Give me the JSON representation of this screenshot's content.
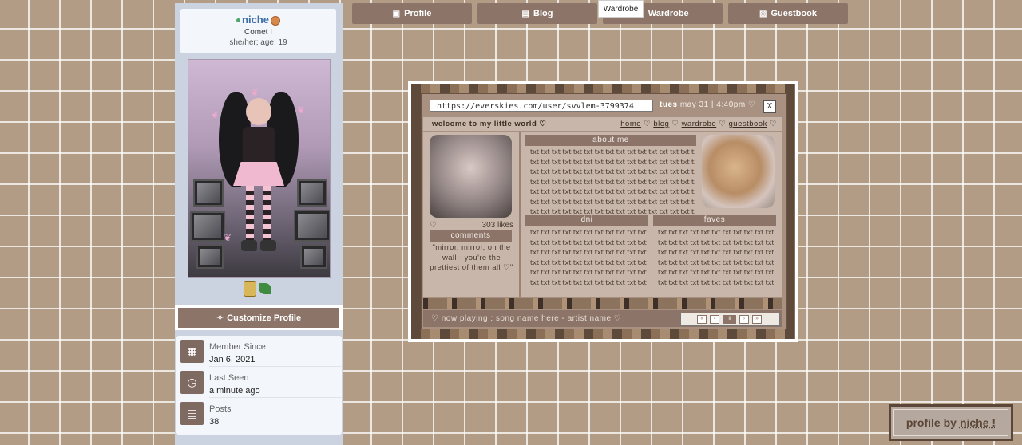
{
  "profile": {
    "username": "niche",
    "display_name": "Comet I",
    "details": "she/her; age: 19",
    "customize_label": "Customize Profile"
  },
  "stats": [
    {
      "label": "Member Since",
      "value": "Jan 6, 2021",
      "icon": "calendar-icon"
    },
    {
      "label": "Last Seen",
      "value": "a minute ago",
      "icon": "clock-calendar-icon"
    },
    {
      "label": "Posts",
      "value": "38",
      "icon": "chat-icon"
    }
  ],
  "tabs": [
    {
      "label": "Profile",
      "icon": "profile-icon"
    },
    {
      "label": "Blog",
      "icon": "blog-icon"
    },
    {
      "label": "Wardrobe",
      "icon": "wardrobe-icon"
    },
    {
      "label": "Guestbook",
      "icon": "guestbook-icon"
    }
  ],
  "tooltip": "Wardrobe",
  "embed": {
    "url": "https://everskies.com/user/svvlem-3799374",
    "date_day": "tues",
    "date_rest": "may 31 | 4:40pm ♡",
    "close_label": "X",
    "welcome": "welcome to my little world ♡",
    "nav_links": [
      "home",
      "blog",
      "wardrobe",
      "guestbook"
    ],
    "likes_heart": "♡",
    "likes": "303 likes",
    "comments_header": "comments",
    "comment": "\"mirror, mirror, on the wall - you're the prettiest of them all ♡\"",
    "about_header": "about me",
    "dni_header": "dni",
    "faves_header": "faves",
    "filler_word": "txt",
    "now_playing_label": "♡ now playing :",
    "now_playing_song": "song name here - artist name ♡",
    "player_buttons": [
      "«",
      "‹",
      "II",
      "›",
      "»"
    ]
  },
  "stamp": {
    "prefix": "profile by",
    "name": "niche !"
  },
  "colors": {
    "accent": "#8c7568",
    "background": "#b39c86",
    "panel": "#cbd3e0",
    "link": "#3d6ea8"
  }
}
